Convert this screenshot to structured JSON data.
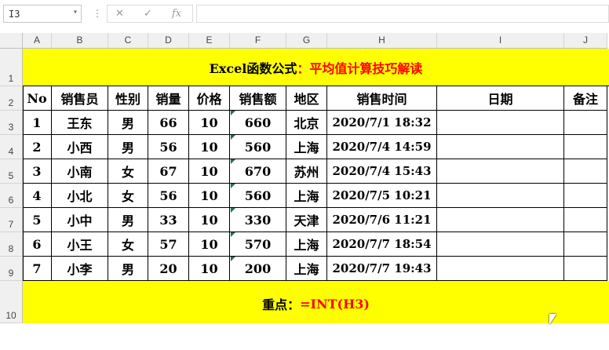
{
  "formula_bar": {
    "name_box": "I3",
    "fx_label": "fx",
    "formula": ""
  },
  "columns": [
    "A",
    "B",
    "C",
    "D",
    "E",
    "F",
    "G",
    "H",
    "I",
    "J"
  ],
  "rows": [
    "1",
    "2",
    "3",
    "4",
    "5",
    "6",
    "7",
    "8",
    "9",
    "10"
  ],
  "title": {
    "black": "Excel函数公式",
    "red": "：平均值计算技巧解读"
  },
  "headers": [
    "No",
    "销售员",
    "性别",
    "销量",
    "价格",
    "销售额",
    "地区",
    "销售时间",
    "日期",
    "备注"
  ],
  "table": [
    [
      "1",
      "王东",
      "男",
      "66",
      "10",
      "660",
      "北京",
      "2020/7/1 18:32",
      "",
      ""
    ],
    [
      "2",
      "小西",
      "男",
      "56",
      "10",
      "560",
      "上海",
      "2020/7/4 14:59",
      "",
      ""
    ],
    [
      "3",
      "小南",
      "女",
      "67",
      "10",
      "670",
      "苏州",
      "2020/7/4 15:43",
      "",
      ""
    ],
    [
      "4",
      "小北",
      "女",
      "56",
      "10",
      "560",
      "上海",
      "2020/7/5 10:21",
      "",
      ""
    ],
    [
      "5",
      "小中",
      "男",
      "33",
      "10",
      "330",
      "天津",
      "2020/7/6 11:21",
      "",
      ""
    ],
    [
      "6",
      "小王",
      "女",
      "57",
      "10",
      "570",
      "上海",
      "2020/7/7 18:54",
      "",
      ""
    ],
    [
      "7",
      "小李",
      "男",
      "20",
      "10",
      "200",
      "上海",
      "2020/7/7 19:43",
      "",
      ""
    ]
  ],
  "footer": {
    "black": "重点：",
    "red": "=INT(H3)"
  },
  "colors": {
    "highlight": "#ffff00",
    "accent_red": "#ff0000",
    "excel_green": "#217346"
  }
}
